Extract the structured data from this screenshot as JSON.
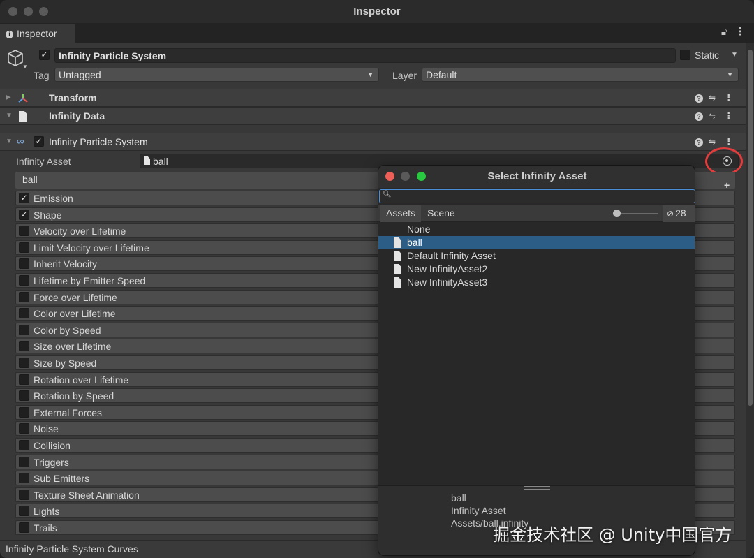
{
  "window": {
    "title": "Inspector"
  },
  "tab": {
    "label": "Inspector"
  },
  "object": {
    "name": "Infinity Particle System",
    "static_label": "Static",
    "tag_label": "Tag",
    "tag_value": "Untagged",
    "layer_label": "Layer",
    "layer_value": "Default"
  },
  "components": [
    {
      "title": "Transform"
    },
    {
      "title": "Infinity Data"
    },
    {
      "title": "Infinity Particle System"
    }
  ],
  "infinity_asset": {
    "label": "Infinity Asset",
    "value": "ball",
    "header": "ball"
  },
  "modules": [
    {
      "label": "Emission",
      "checked": true
    },
    {
      "label": "Shape",
      "checked": true
    },
    {
      "label": "Velocity over Lifetime",
      "checked": false
    },
    {
      "label": "Limit Velocity over Lifetime",
      "checked": false
    },
    {
      "label": "Inherit Velocity",
      "checked": false
    },
    {
      "label": "Lifetime by Emitter Speed",
      "checked": false
    },
    {
      "label": "Force over Lifetime",
      "checked": false
    },
    {
      "label": "Color over Lifetime",
      "checked": false
    },
    {
      "label": "Color by Speed",
      "checked": false
    },
    {
      "label": "Size over Lifetime",
      "checked": false
    },
    {
      "label": "Size by Speed",
      "checked": false
    },
    {
      "label": "Rotation over Lifetime",
      "checked": false
    },
    {
      "label": "Rotation by Speed",
      "checked": false
    },
    {
      "label": "External Forces",
      "checked": false
    },
    {
      "label": "Noise",
      "checked": false
    },
    {
      "label": "Collision",
      "checked": false
    },
    {
      "label": "Triggers",
      "checked": false
    },
    {
      "label": "Sub Emitters",
      "checked": false
    },
    {
      "label": "Texture Sheet Animation",
      "checked": false
    },
    {
      "label": "Lights",
      "checked": false
    },
    {
      "label": "Trails",
      "checked": false
    }
  ],
  "curves": {
    "label": "Infinity Particle System Curves"
  },
  "popup": {
    "title": "Select Infinity Asset",
    "search_value": "",
    "tabs": [
      "Assets",
      "Scene"
    ],
    "hidden_count": "28",
    "items": [
      {
        "name": "None",
        "icon": false,
        "selected": false
      },
      {
        "name": "ball",
        "icon": true,
        "selected": true
      },
      {
        "name": "Default Infinity Asset",
        "icon": true,
        "selected": false
      },
      {
        "name": "New InfinityAsset2",
        "icon": true,
        "selected": false
      },
      {
        "name": "New InfinityAsset3",
        "icon": true,
        "selected": false
      }
    ],
    "info": {
      "name": "ball",
      "type": "Infinity Asset",
      "path": "Assets/ball.infinity"
    }
  },
  "watermark": "掘金技术社区 @ Unity中国官方",
  "colors": {
    "selection": "#2c5d87",
    "highlight_ring": "#e23d3d",
    "close": "#ed5f57",
    "minimize": "#5a5a5a",
    "zoom": "#28c840",
    "search_focus": "#4a8fd8"
  }
}
